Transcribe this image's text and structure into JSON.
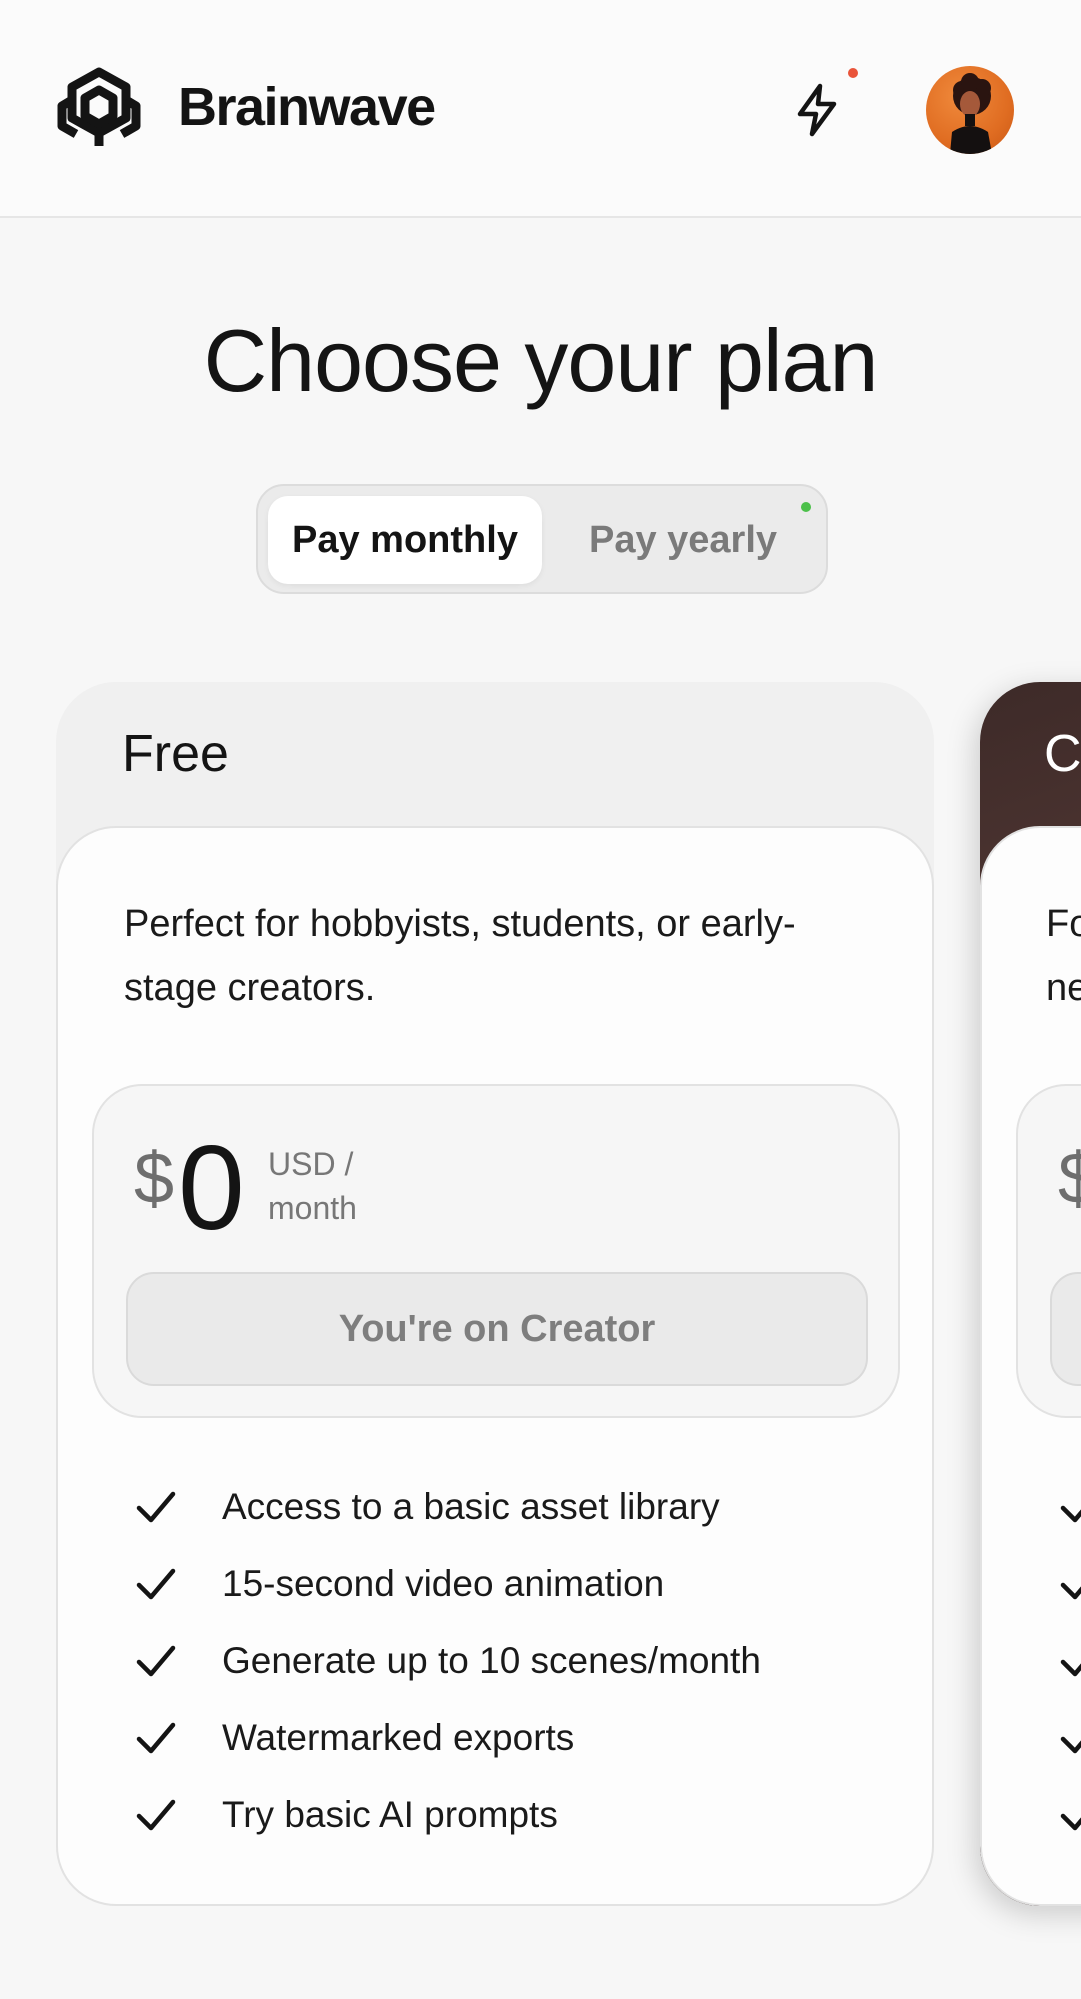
{
  "header": {
    "brand": "Brainwave",
    "logo_icon": "brainwave-logo-icon",
    "bolt_icon": "lightning-bolt-icon",
    "notification_color": "#e9543a",
    "avatar": "user-avatar"
  },
  "page": {
    "title": "Choose your plan"
  },
  "billing_toggle": {
    "monthly_label": "Pay monthly",
    "yearly_label": "Pay yearly",
    "selected": "Pay monthly",
    "yearly_dot_color": "#4cc04a"
  },
  "plans": [
    {
      "name": "Free",
      "description": "Perfect for hobbyists, students, or early-stage creators.",
      "currency_symbol": "$",
      "price": "0",
      "unit_line1": "USD /",
      "unit_line2": "month",
      "button_label": "You're on Creator",
      "features": [
        "Access to a basic asset library",
        "15-second video animation",
        "Generate up to 10 scenes/month",
        "Watermarked exports",
        "Try basic AI prompts"
      ]
    },
    {
      "name_visible": "C",
      "description_visible_line1": "Fo",
      "description_visible_line2": "ne",
      "currency_symbol": "$"
    }
  ]
}
